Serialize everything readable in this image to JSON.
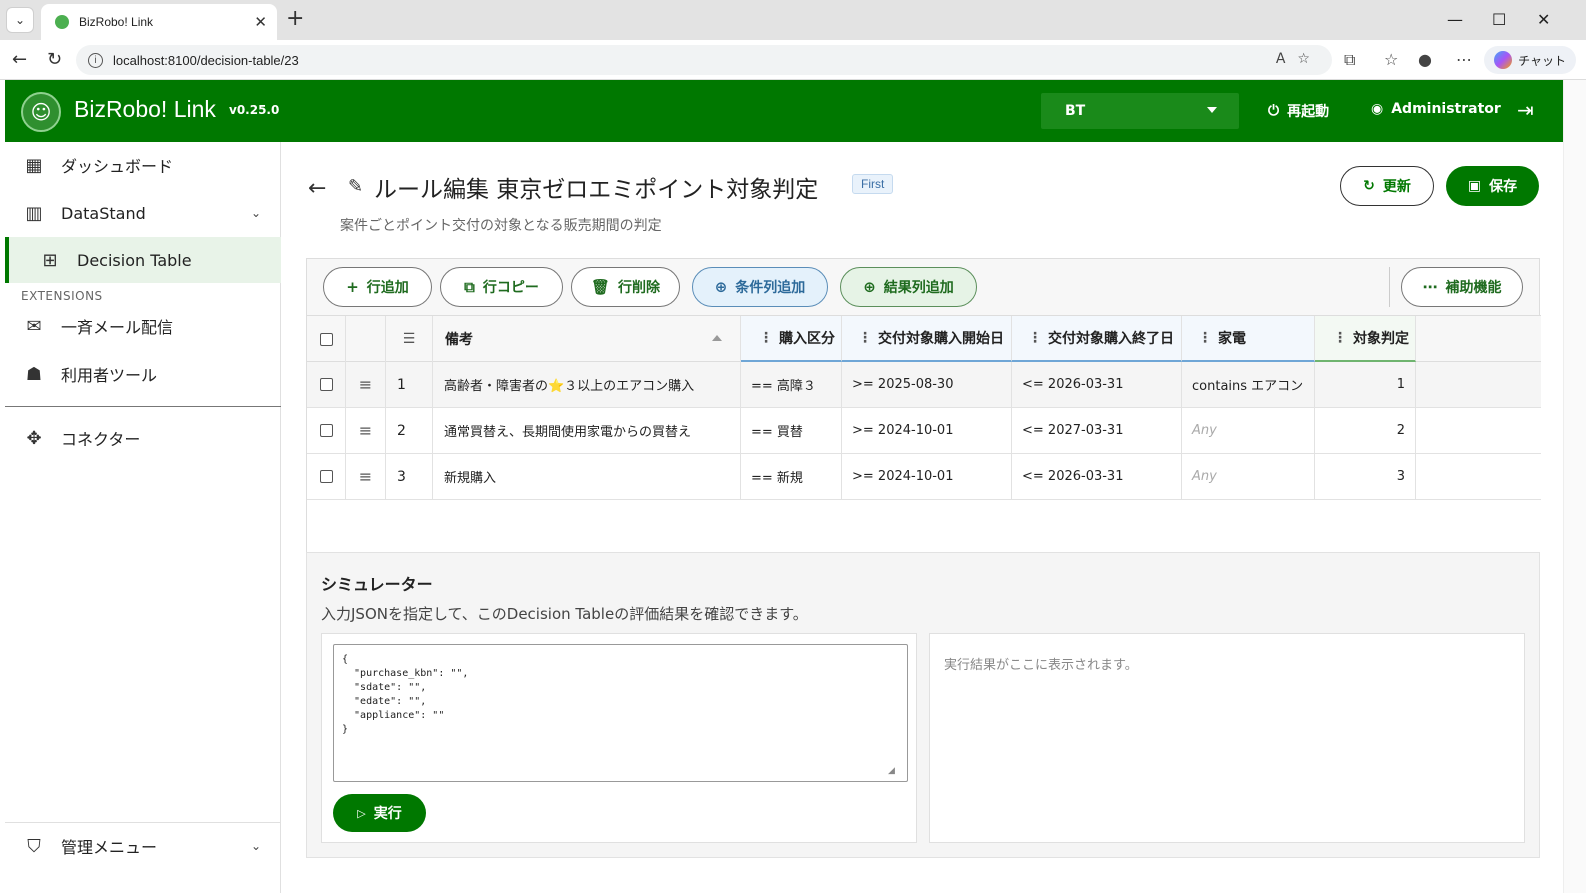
{
  "browser": {
    "tab_title": "BizRobo! Link",
    "url": "localhost:8100/decision-table/23",
    "copilot_label": "チャット"
  },
  "header": {
    "app_name": "BizRobo! Link",
    "version": "v0.25.0",
    "tenant": "BT",
    "restart_label": "再起動",
    "user_label": "Administrator",
    "brand_color": "#007800"
  },
  "sidebar": {
    "items": [
      {
        "label": "ダッシュボード",
        "icon": "dashboard-icon"
      },
      {
        "label": "DataStand",
        "icon": "bar-chart-icon"
      },
      {
        "label": "Decision Table",
        "icon": "table-icon"
      },
      {
        "label": "一斉メール配信",
        "icon": "mail-send-icon"
      },
      {
        "label": "利用者ツール",
        "icon": "user-tool-icon"
      },
      {
        "label": "コネクター",
        "icon": "puzzle-icon"
      },
      {
        "label": "管理メニュー",
        "icon": "admin-shield-icon"
      }
    ],
    "section_extensions": "EXTENSIONS"
  },
  "page": {
    "title": "ルール編集 東京ゼロエミポイント対象判定",
    "badge": "First",
    "subtitle": "案件ごとポイント交付の対象となる販売期間の判定",
    "update_label": "更新",
    "save_label": "保存"
  },
  "toolbar": {
    "add_row": "行追加",
    "copy_row": "行コピー",
    "delete_row": "行削除",
    "add_condition_col": "条件列追加",
    "add_result_col": "結果列追加",
    "helpers": "補助機能"
  },
  "table": {
    "columns": {
      "memo": "備考",
      "purchase_kbn": "購入区分",
      "sdate": "交付対象購入開始日",
      "edate": "交付対象購入終了日",
      "appliance": "家電",
      "result": "対象判定"
    },
    "rows": [
      {
        "no": "1",
        "memo": "高齢者・障害者の⭐３以上のエアコン購入",
        "purchase_kbn": "== 高障３",
        "sdate": ">= 2025-08-30",
        "edate": "<= 2026-03-31",
        "appliance": "contains エアコン",
        "result": "1"
      },
      {
        "no": "2",
        "memo": "通常買替え、長期間使用家電からの買替え",
        "purchase_kbn": "== 買替",
        "sdate": ">= 2024-10-01",
        "edate": "<= 2027-03-31",
        "appliance": "Any",
        "result": "2"
      },
      {
        "no": "3",
        "memo": "新規購入",
        "purchase_kbn": "== 新規",
        "sdate": ">= 2024-10-01",
        "edate": "<= 2026-03-31",
        "appliance": "Any",
        "result": "3"
      }
    ]
  },
  "simulator": {
    "title": "シミュレーター",
    "description": "入力JSONを指定して、このDecision Tableの評価結果を確認できます。",
    "input_json": "{\n  \"purchase_kbn\": \"\",\n  \"sdate\": \"\",\n  \"edate\": \"\",\n  \"appliance\": \"\"\n}",
    "run_label": "実行",
    "result_placeholder": "実行結果がここに表示されます。"
  }
}
